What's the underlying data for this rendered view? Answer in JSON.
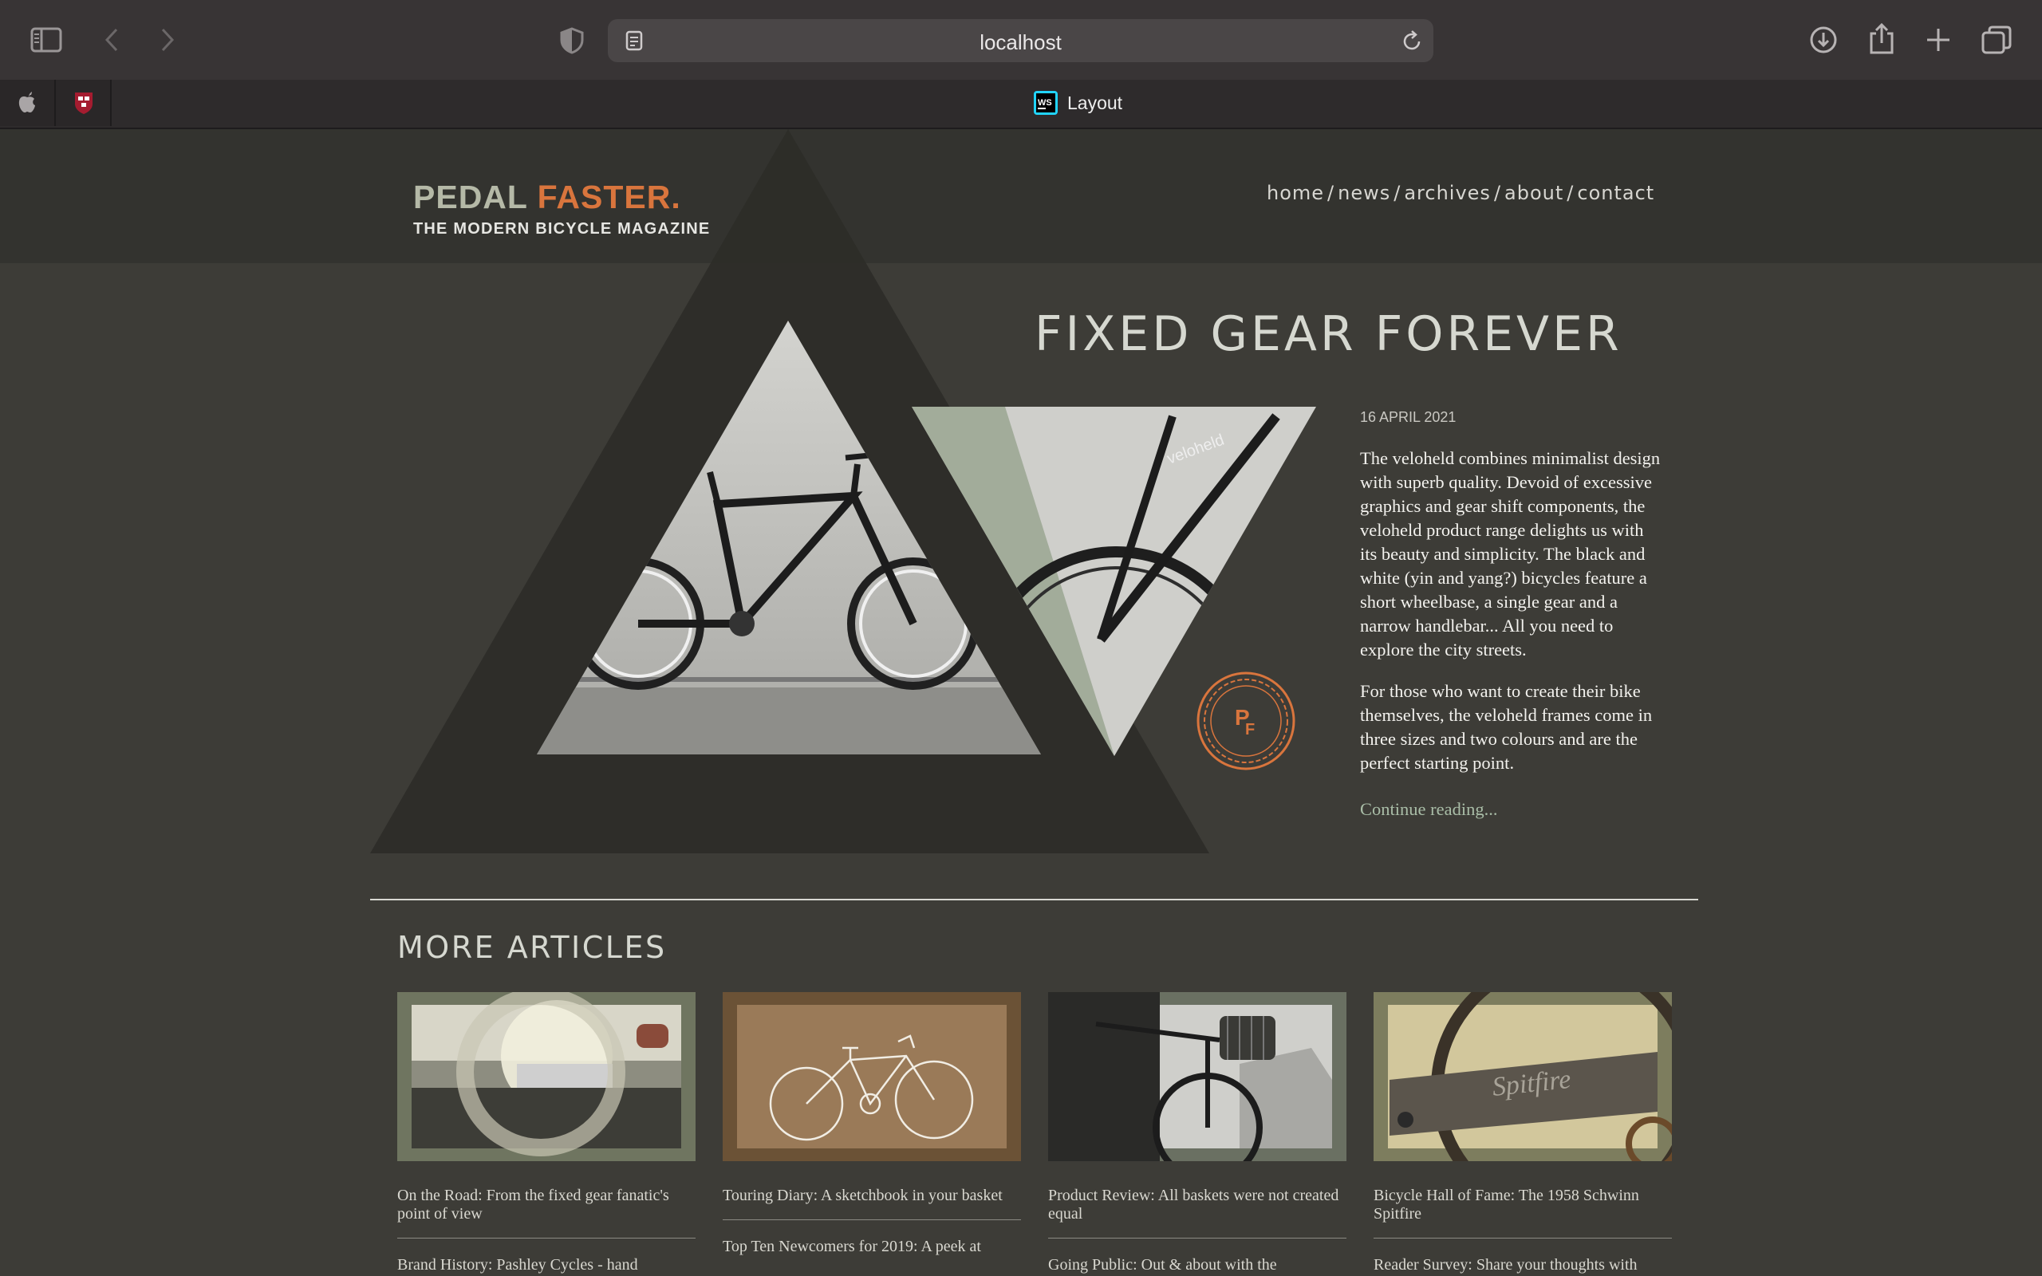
{
  "browser": {
    "url": "localhost",
    "active_tab_title": "Layout",
    "pinned_tabs": [
      "apple-tab",
      "harvard-tab"
    ]
  },
  "site": {
    "logo_word1": "PEDAL",
    "logo_word2": "FASTER.",
    "tagline": "THE MODERN BICYCLE MAGAZINE",
    "nav": [
      {
        "label": "home"
      },
      {
        "label": "news"
      },
      {
        "label": "archives"
      },
      {
        "label": "about"
      },
      {
        "label": "contact"
      }
    ],
    "nav_separator": "/"
  },
  "feature": {
    "title": "FIXED GEAR FOREVER",
    "date": "16 APRIL 2021",
    "paragraphs": [
      "The veloheld combines minimalist design with superb quality. Devoid of excessive graphics and gear shift components, the veloheld product range delights us with its beauty and simplicity. The black and white (yin and yang?) bicycles feature a short wheelbase, a single gear and a narrow handlebar... All you need to explore the city streets.",
      "For those who want to create their bike themselves, the veloheld frames come in three sizes and two colours and are the perfect starting point."
    ],
    "continue_label": "Continue reading...",
    "badge_text_p": "P",
    "badge_text_f": "F",
    "frame_text": "veloheld"
  },
  "more": {
    "title": "MORE ARTICLES",
    "cards": [
      {
        "title": "On the Road: From the fixed gear fanatic's point of view",
        "next": "Brand History: Pashley Cycles - hand"
      },
      {
        "title": "Touring Diary: A sketchbook in your basket",
        "next": "Top Ten Newcomers for 2019: A peek at"
      },
      {
        "title": "Product Review: All baskets were not created equal",
        "next": "Going Public: Out & about with the"
      },
      {
        "title": "Bicycle Hall of Fame: The 1958 Schwinn Spitfire",
        "next": "Reader Survey: Share your thoughts with"
      }
    ],
    "spitfire_text": "Spitfire"
  },
  "colors": {
    "accent": "#d9753d",
    "page_bg": "#3d3c37",
    "header_band": "#33332f",
    "triangle": "#2c2c28",
    "link": "#a9bda7"
  }
}
